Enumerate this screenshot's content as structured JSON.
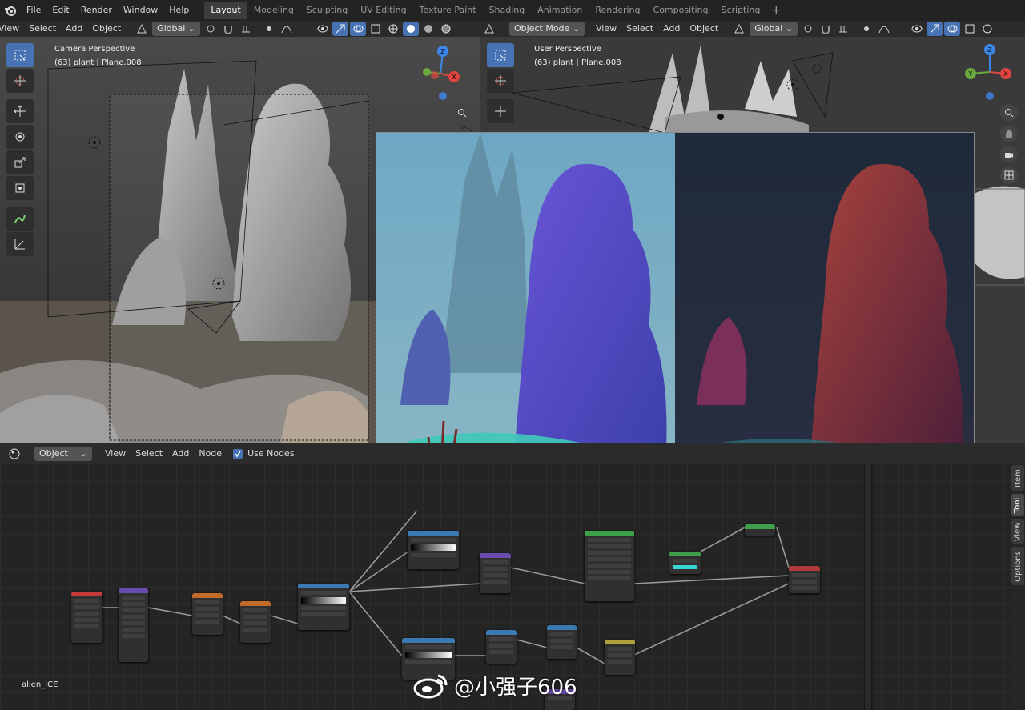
{
  "topbar": {
    "menus": [
      "File",
      "Edit",
      "Render",
      "Window",
      "Help"
    ],
    "workspaces": [
      "Layout",
      "Modeling",
      "Sculpting",
      "UV Editing",
      "Texture Paint",
      "Shading",
      "Animation",
      "Rendering",
      "Compositing",
      "Scripting"
    ],
    "active_workspace": "Layout",
    "add_tab": "+"
  },
  "left_viewport": {
    "menus": {
      "view": "View",
      "select": "Select",
      "add": "Add",
      "object": "Object"
    },
    "orientation": "Global",
    "title": "Camera Perspective",
    "subtitle": "(63) plant | Plane.008"
  },
  "right_viewport": {
    "mode": "Object Mode",
    "menus": {
      "view": "View",
      "select": "Select",
      "add": "Add",
      "object": "Object"
    },
    "orientation": "Global",
    "title": "User Perspective",
    "subtitle": "(63) plant | Plane.008"
  },
  "gizmo": {
    "x": "X",
    "y": "Y",
    "z": "Z"
  },
  "node_editor": {
    "type": "Object",
    "menus": {
      "view": "View",
      "select": "Select",
      "add": "Add",
      "node": "Node"
    },
    "use_nodes_label": "Use Nodes",
    "use_nodes_checked": true,
    "scene_name": "alien_ICE"
  },
  "side_tabs": [
    "Item",
    "Tool",
    "View",
    "Options"
  ],
  "active_side_tab": "Tool",
  "watermark": "@小强子606",
  "colors": {
    "accent": "#4772b3",
    "x_axis": "#e0453f",
    "y_axis": "#6aaa3f",
    "z_axis": "#3d86e8"
  }
}
